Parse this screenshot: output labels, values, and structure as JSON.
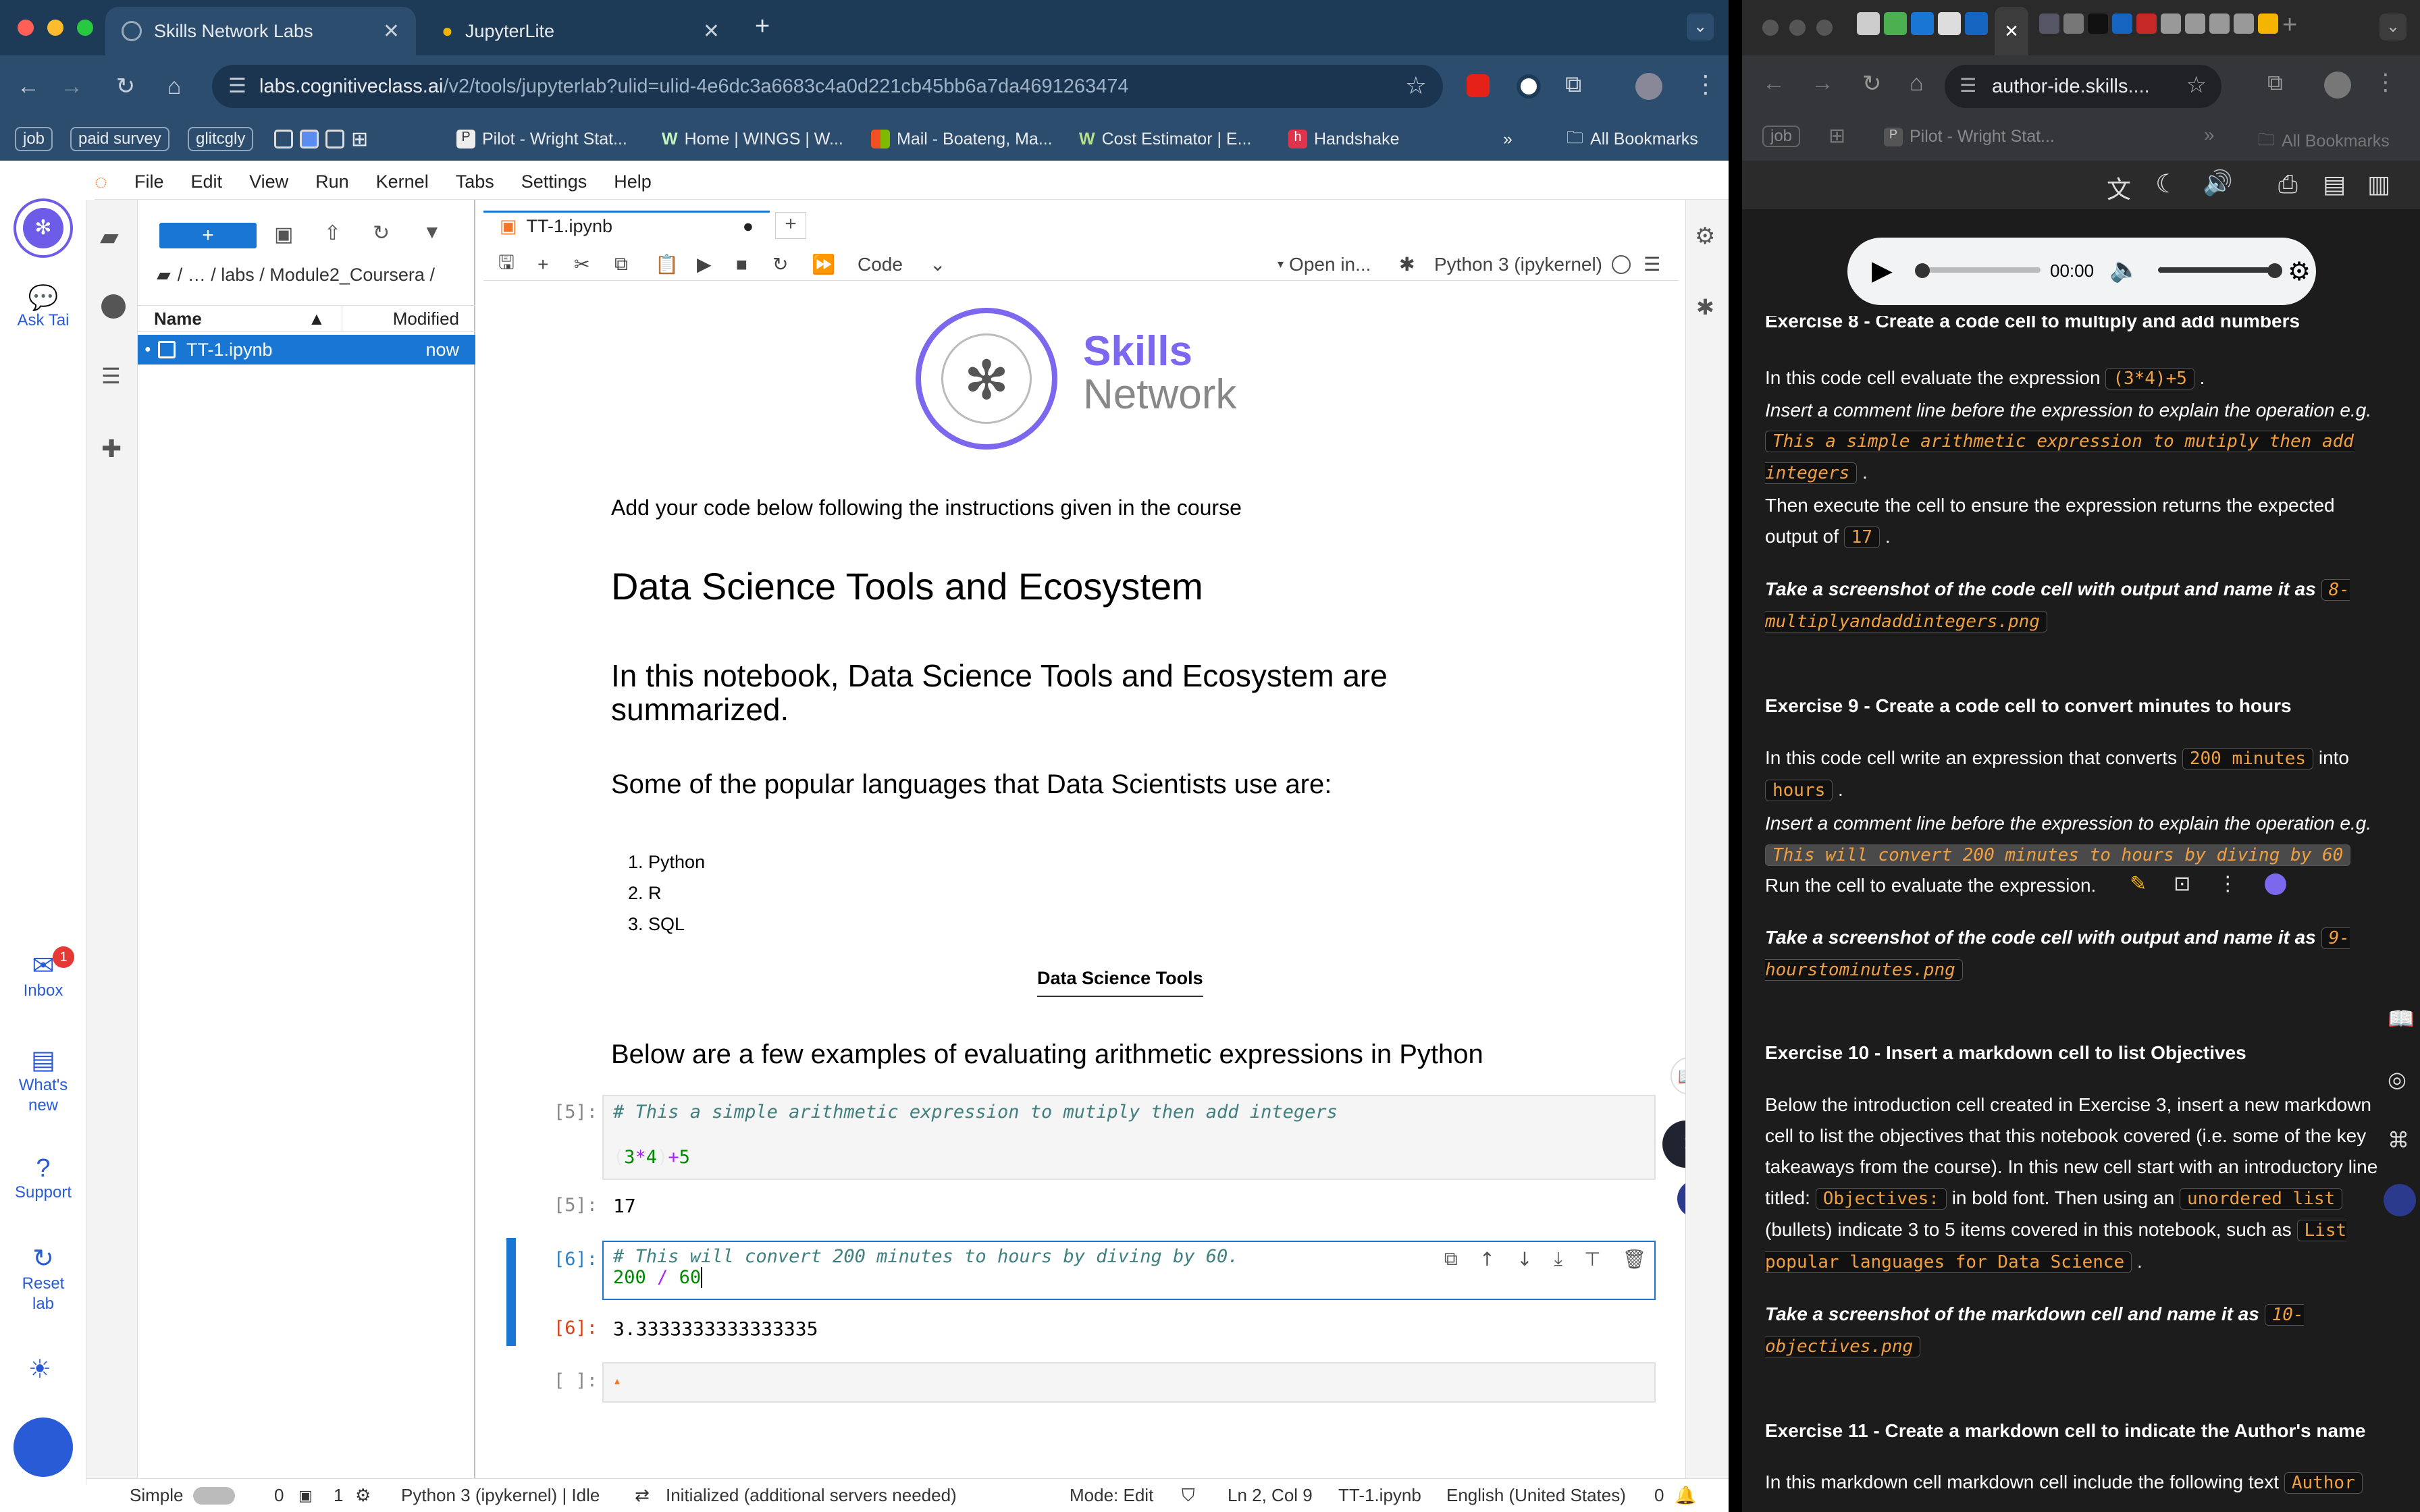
{
  "left_browser": {
    "tabs": [
      {
        "title": "Skills Network Labs",
        "active": true
      },
      {
        "title": "JupyterLite",
        "active": false
      }
    ],
    "url_host": "labs.cognitiveclass.ai",
    "url_path": "/v2/tools/jupyterlab?ulid=ulid-4e6dc3a6683c4a0d221cb45bb6a7da4691263474",
    "bookmarks": [
      "job",
      "paid survey",
      "glitcgly",
      "Pilot - Wright Stat...",
      "Home | WINGS | W...",
      "Mail - Boateng, Ma...",
      "Cost Estimator | E...",
      "Handshake"
    ],
    "all_bookmarks": "All Bookmarks"
  },
  "jupyter": {
    "menu": [
      "File",
      "Edit",
      "View",
      "Run",
      "Kernel",
      "Tabs",
      "Settings",
      "Help"
    ],
    "sidebar": [
      {
        "label": "Ask Tai"
      },
      {
        "label": "Inbox",
        "badge": "1"
      },
      {
        "label": "What's new"
      },
      {
        "label": "Support"
      },
      {
        "label": "Reset lab"
      }
    ],
    "filebrowser": {
      "breadcrumb": "/  …  / labs / Module2_Coursera /",
      "col_name": "Name",
      "col_modified": "Modified",
      "file_name": "TT-1.ipynb",
      "file_modified": "now"
    },
    "notebook_tab": "TT-1.ipynb",
    "cell_type": "Code",
    "open_in": "Open in...",
    "kernel": "Python 3 (ipykernel)",
    "logo_line1": "Skills",
    "logo_line2": "Network",
    "md_intro": "Add your code below following the instructions given in the course",
    "h1": "Data Science Tools and Ecosystem",
    "h2": "In this notebook, Data Science Tools and Ecosystem are summarized.",
    "h3_languages": "Some of the popular languages that Data Scientists use are:",
    "languages": [
      "Python",
      "R",
      "SQL"
    ],
    "table_header": "Data Science Tools",
    "h3_examples": "Below are a few examples of evaluating arithmetic expressions in Python",
    "cells": [
      {
        "prompt": "[5]:",
        "comment": "# This a simple arithmetic expression to mutiply then add integers",
        "code": "(3*4)+5",
        "out_prompt": "[5]:",
        "output": "17"
      },
      {
        "prompt": "[6]:",
        "comment": "# This will convert 200 minutes to hours by diving by 60.",
        "code": "200 / 60",
        "out_prompt": "[6]:",
        "output": "3.3333333333333335"
      },
      {
        "prompt": "[ ]:"
      }
    ],
    "status": {
      "mode_label": "Simple",
      "count1": "0",
      "count2": "1",
      "kernel_status": "Python 3 (ipykernel) | Idle",
      "init": "Initialized (additional servers needed)",
      "mode": "Mode: Edit",
      "position": "Ln 2, Col 9",
      "file": "TT-1.ipynb",
      "lang": "English (United States)",
      "notif": "0"
    }
  },
  "right_browser": {
    "url": "author-ide.skills....",
    "bookmark": "Pilot - Wright Stat...",
    "chip": "job",
    "all_bookmarks": "All Bookmarks",
    "audio_time": "00:00",
    "ex8": {
      "title": "Exercise 8 - Create a code cell to multiply and add numbers",
      "l1": "In this code cell evaluate the expression",
      "c1": "(3*4)+5",
      "l2": "Insert a comment line before the expression to explain the operation e.g.",
      "c2": "This a simple arithmetic expression to mutiply then add integers",
      "l3": "Then execute the cell to ensure the expression returns the expected output of",
      "c3": "17",
      "l4": "Take a screenshot of the code cell with output and name it as",
      "c4": "8-multiplyandaddintegers.png"
    },
    "ex9": {
      "title": "Exercise 9 - Create a code cell to convert minutes to hours",
      "l1": "In this code cell write an expression that converts",
      "c1": "200 minutes",
      "l1b": "into",
      "c1b": "hours",
      "l2": "Insert a comment line before the expression to explain the operation e.g.",
      "c2": "This will convert 200 minutes to hours by diving by 60",
      "l3": "Run the cell to evaluate the expression.",
      "l4": "Take a screenshot of the code cell with output and name it as",
      "c4": "9-hourstominutes.png"
    },
    "ex10": {
      "title": "Exercise 10 - Insert a markdown cell to list Objectives",
      "l1": "Below the introduction cell created in Exercise 3, insert a new markdown cell to list the objectives that this notebook covered (i.e. some of the key takeaways from the course). In this new cell start with an introductory line titled:",
      "c1": "Objectives:",
      "l1b": "in bold font. Then using an",
      "c1b": "unordered list",
      "l1c": "(bullets) indicate 3 to 5 items covered in this notebook, such as",
      "c1c": "List popular languages for Data Science",
      "l4": "Take a screenshot of the markdown cell and name it as",
      "c4": "10-objectives.png"
    },
    "ex11": {
      "title": "Exercise 11 - Create a markdown cell to indicate the Author's name",
      "l1": "In this markdown cell markdown cell include the following text",
      "c1": "Author"
    }
  }
}
